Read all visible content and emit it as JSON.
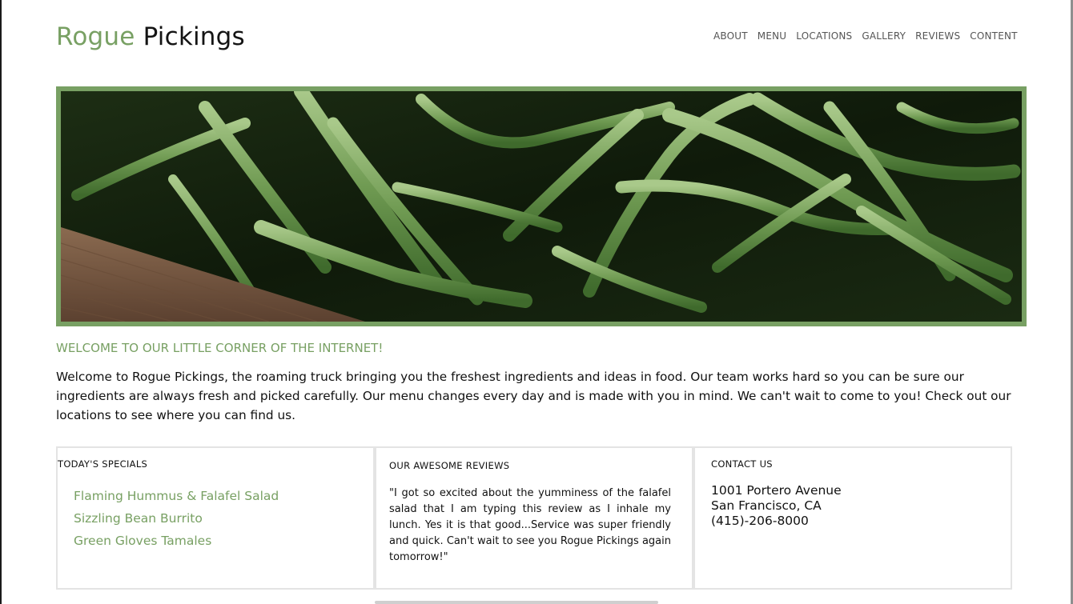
{
  "brand": {
    "first": "Rogue",
    "second": " Pickings",
    "accent_color": "#78a063"
  },
  "nav": [
    {
      "label": "ABOUT"
    },
    {
      "label": "MENU"
    },
    {
      "label": "LOCATIONS"
    },
    {
      "label": "GALLERY"
    },
    {
      "label": "REVIEWS"
    },
    {
      "label": "CONTENT"
    }
  ],
  "hero": {
    "image": "green-beans-photo"
  },
  "welcome": {
    "title": "WELCOME TO OUR LITTLE CORNER OF THE INTERNET!",
    "text": "Welcome to Rogue Pickings, the roaming truck bringing you the freshest ingredients and ideas in food. Our team works hard so you can be sure our ingredients are always fresh and picked carefully. Our menu changes every day and is made with you in mind. We can't wait to come to you! Check out our locations to see where you can find us."
  },
  "specials": {
    "title": "TODAY'S SPECIALS",
    "items": [
      {
        "label": "Flaming Hummus & Falafel Salad"
      },
      {
        "label": "Sizzling Bean Burrito"
      },
      {
        "label": "Green Gloves Tamales"
      }
    ]
  },
  "reviews": {
    "title": "OUR AWESOME REVIEWS",
    "text": "\"I got so excited about the yumminess of the falafel salad that I am typing this review as I inhale my lunch. Yes it is that good...Service was super friendly and quick. Can't wait to see you Rogue Pickings again tomorrow!\""
  },
  "contact": {
    "title": "CONTACT US",
    "address_line1": "1001 Portero Avenue",
    "address_line2": "San Francisco, CA",
    "phone": "(415)-206-8000"
  }
}
